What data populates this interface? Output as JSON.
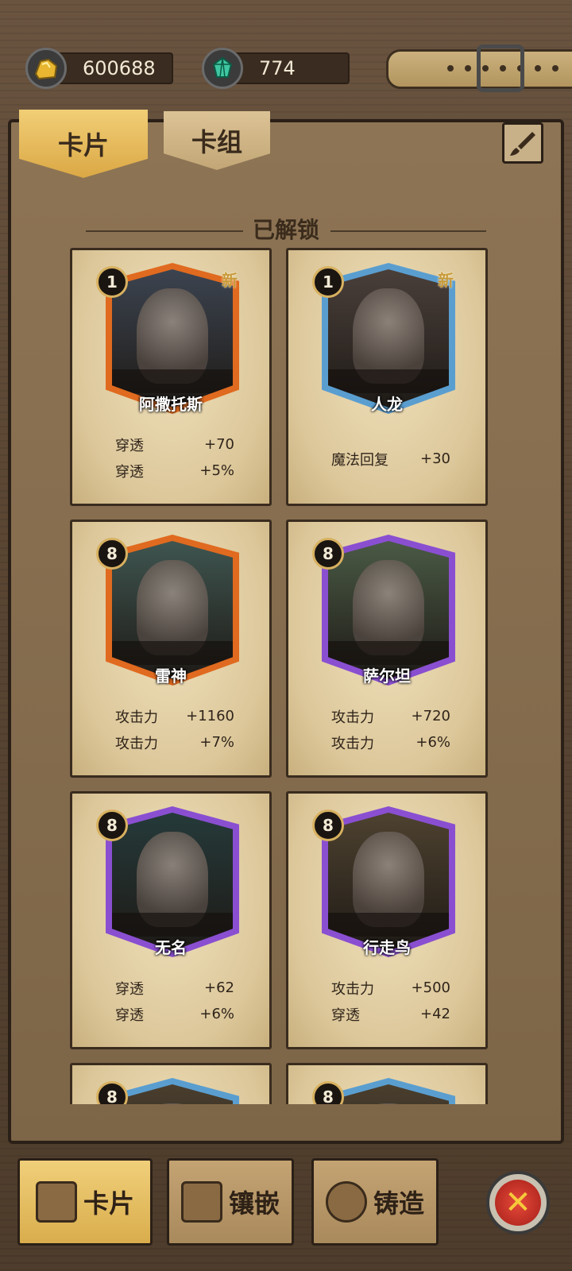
{
  "currency": {
    "gold": "600688",
    "gems": "774",
    "gold_icon": "gold-nugget-icon",
    "gem_icon": "gem-icon"
  },
  "tabs": [
    {
      "label": "卡片"
    },
    {
      "label": "卡组"
    }
  ],
  "section_title": "已解锁",
  "cards": [
    {
      "name": "阿撒托斯",
      "level": "1",
      "new_badge": "新",
      "frame": "#e06a1f",
      "stats": [
        {
          "label": "穿透",
          "value": "+70"
        },
        {
          "label": "穿透",
          "value": "+5%"
        }
      ]
    },
    {
      "name": "人龙",
      "level": "1",
      "new_badge": "新",
      "frame": "#5a9ed0",
      "stats": [
        {
          "label": "魔法回复",
          "value": "+30"
        }
      ]
    },
    {
      "name": "雷神",
      "level": "8",
      "frame": "#e06a1f",
      "stats": [
        {
          "label": "攻击力",
          "value": "+1160"
        },
        {
          "label": "攻击力",
          "value": "+7%"
        }
      ]
    },
    {
      "name": "萨尔坦",
      "level": "8",
      "frame": "#8a4fd1",
      "stats": [
        {
          "label": "攻击力",
          "value": "+720"
        },
        {
          "label": "攻击力",
          "value": "+6%"
        }
      ]
    },
    {
      "name": "无名",
      "level": "8",
      "frame": "#8a4fd1",
      "stats": [
        {
          "label": "穿透",
          "value": "+62"
        },
        {
          "label": "穿透",
          "value": "+6%"
        }
      ]
    },
    {
      "name": "行走鸟",
      "level": "8",
      "frame": "#8a4fd1",
      "stats": [
        {
          "label": "攻击力",
          "value": "+500"
        },
        {
          "label": "穿透",
          "value": "+42"
        }
      ]
    },
    {
      "name": "",
      "level": "8",
      "frame": "#5a9ed0",
      "stats": []
    },
    {
      "name": "",
      "level": "8",
      "frame": "#5a9ed0",
      "stats": []
    }
  ],
  "bottom_nav": [
    {
      "label": "卡片",
      "icon": "cards-icon"
    },
    {
      "label": "镶嵌",
      "icon": "inlay-book-icon"
    },
    {
      "label": "铸造",
      "icon": "forge-icon"
    }
  ],
  "colors": {
    "orange_frame": "#e06a1f",
    "blue_frame": "#5a9ed0",
    "purple_frame": "#8a4fd1",
    "tab_active": "#dba845"
  }
}
